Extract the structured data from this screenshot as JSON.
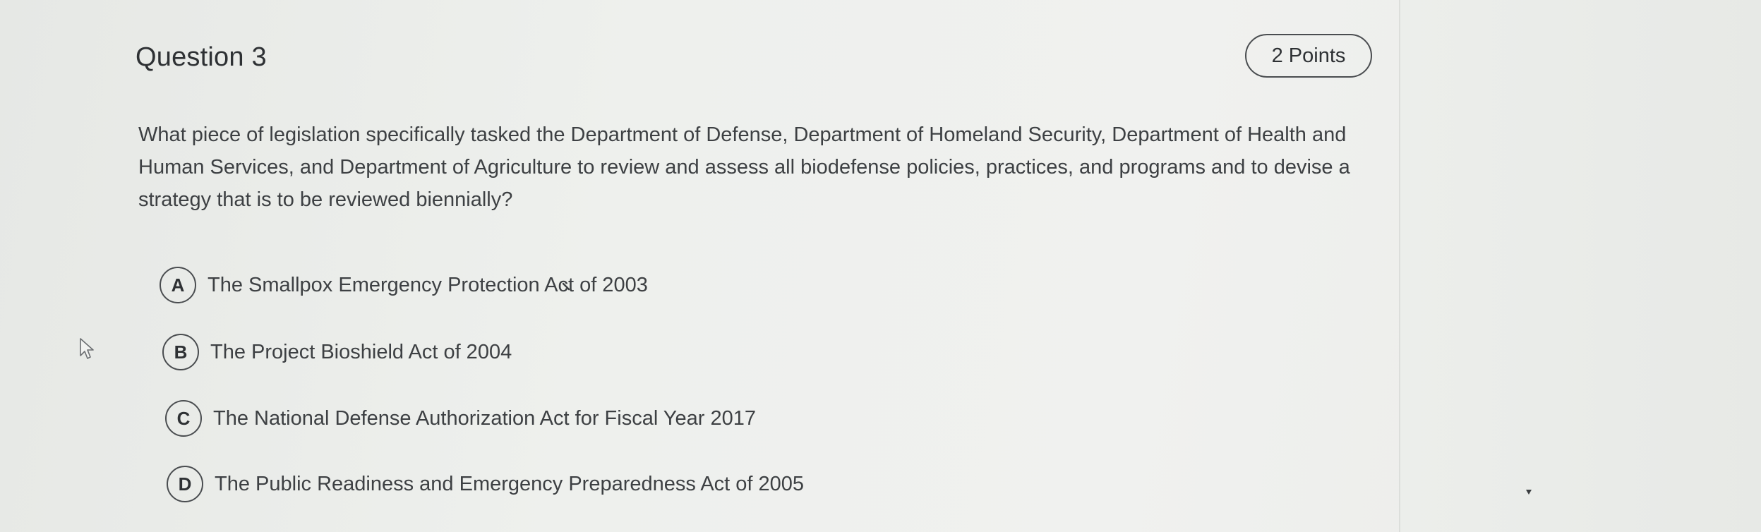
{
  "question": {
    "title": "Question 3",
    "points": "2 Points",
    "text": "What piece of legislation specifically tasked the Department of Defense, Department of Homeland Security, Department of Health and Human Services, and Department of Agriculture to review and assess all biodefense policies, practices, and programs and to devise a strategy that is to be reviewed biennially?"
  },
  "options": [
    {
      "letter": "A",
      "text": "The Smallpox Emergency Protection Act of 2003"
    },
    {
      "letter": "B",
      "text": "The Project Bioshield Act of 2004"
    },
    {
      "letter": "C",
      "text": "The National Defense Authorization Act for Fiscal Year 2017"
    },
    {
      "letter": "D",
      "text": "The Public Readiness and Emergency Preparedness Act of 2005"
    }
  ],
  "icons": {
    "cursor": "mouse-pointer-icon"
  },
  "colors": {
    "text": "#3d4043",
    "border": "#4a4d50",
    "background": "#eef0ed"
  }
}
